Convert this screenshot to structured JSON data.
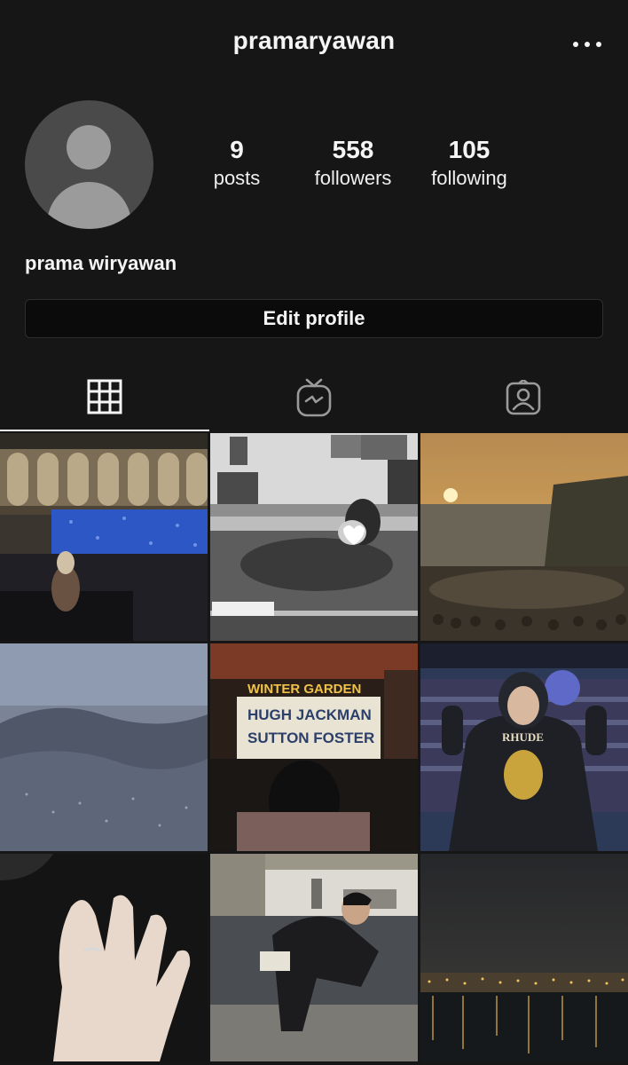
{
  "header": {
    "username": "pramaryawan",
    "more_icon": "more-horizontal-icon"
  },
  "profile": {
    "display_name": "prama wiryawan",
    "avatar_icon": "default-avatar-icon",
    "stats": {
      "posts": {
        "value": "9",
        "label": "posts"
      },
      "followers": {
        "value": "558",
        "label": "followers"
      },
      "following": {
        "value": "105",
        "label": "following"
      }
    },
    "edit_button": "Edit profile"
  },
  "tabs": [
    {
      "icon": "grid-icon",
      "active": true
    },
    {
      "icon": "igtv-icon",
      "active": false
    },
    {
      "icon": "tagged-person-icon",
      "active": false
    }
  ],
  "posts": {
    "poster_1": "WINTER GARDEN",
    "poster_2": "HUGH JACKMAN",
    "poster_3": "SUTTON FOSTER",
    "hoodie_text": "RHUDE"
  },
  "colors": {
    "background": "#161616",
    "text": "#f5f5f5",
    "button_bg": "#0b0b0b"
  }
}
